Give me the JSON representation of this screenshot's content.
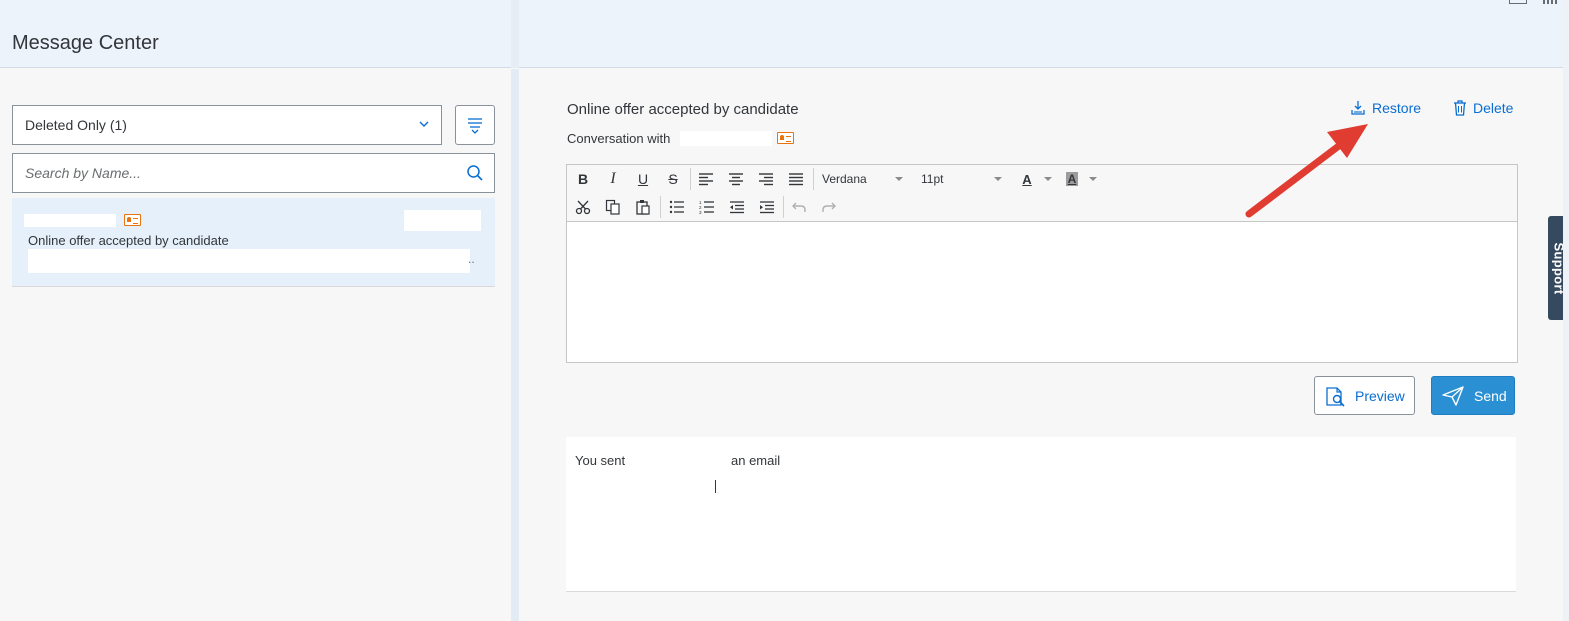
{
  "header": {
    "title": "Message Center"
  },
  "left_panel": {
    "filter": {
      "selected": "Deleted Only (1)"
    },
    "search": {
      "placeholder": "Search by Name..."
    },
    "messages": [
      {
        "subject": "Online offer accepted by candidate",
        "ellipsis": ".."
      }
    ]
  },
  "conversation": {
    "subject": "Online offer accepted by candidate",
    "with_label": "Conversation with",
    "restore_label": "Restore",
    "delete_label": "Delete"
  },
  "editor": {
    "toolbar": {
      "bold": "B",
      "italic": "I",
      "underline": "U",
      "strike": "S",
      "font": "Verdana",
      "size": "11pt",
      "text_color": "A",
      "bg_color": "A"
    }
  },
  "actions": {
    "preview_label": "Preview",
    "send_label": "Send"
  },
  "history": {
    "you_sent": "You sent",
    "an_email": "an email"
  },
  "support": {
    "label": "Support"
  },
  "colors": {
    "accent": "#0a6ed1",
    "send": "#2b8fd3",
    "annotation": "#e03c31",
    "contact": "#e9730c"
  }
}
